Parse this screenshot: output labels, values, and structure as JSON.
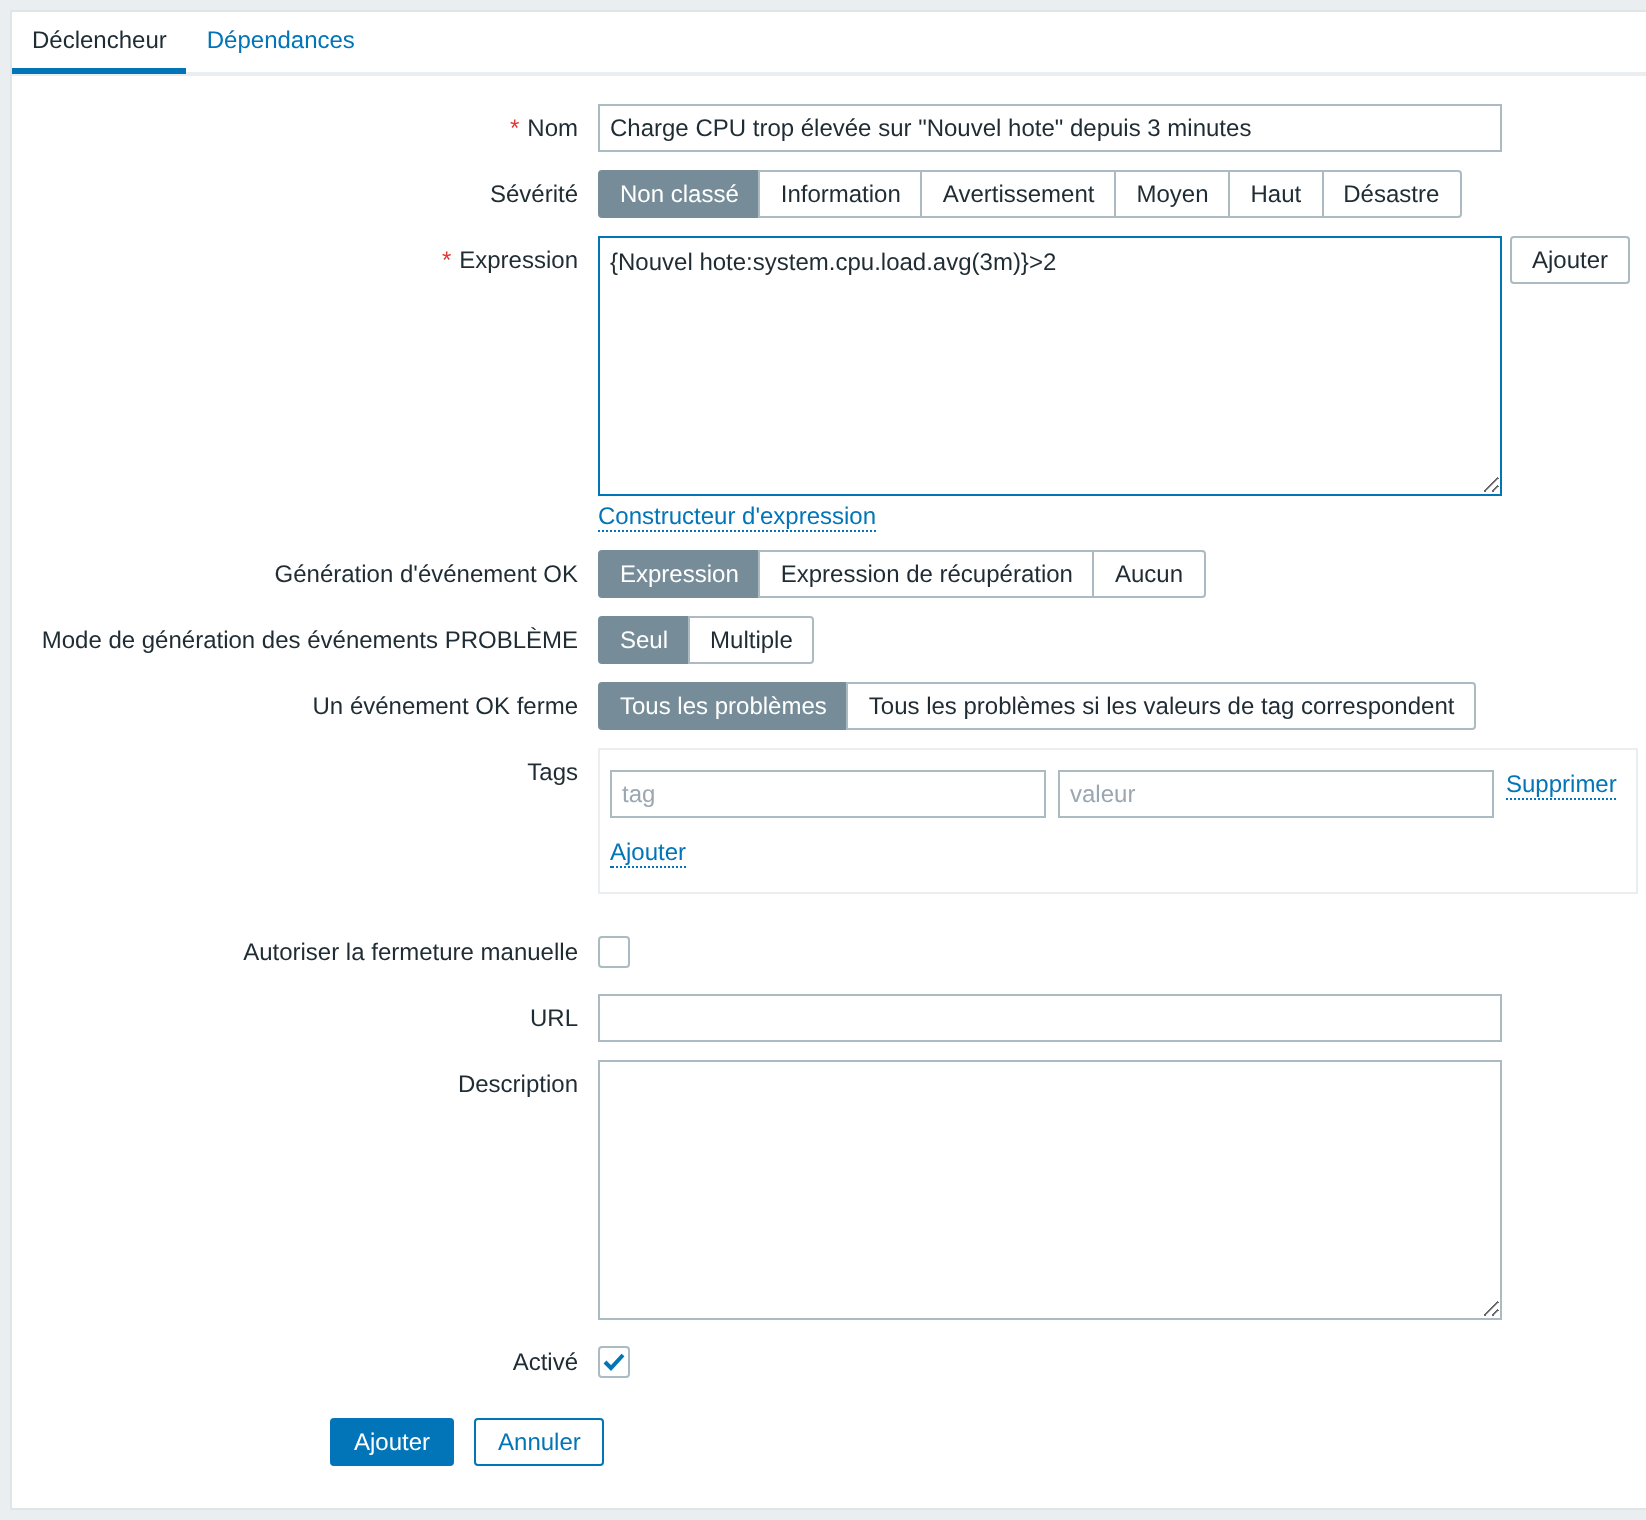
{
  "tabs": [
    {
      "label": "Déclencheur",
      "selected": true
    },
    {
      "label": "Dépendances",
      "selected": false
    }
  ],
  "fields": [
    {
      "kind": "input",
      "label": "Nom",
      "marker": "*",
      "value": "Charge CPU trop élevée sur \"Nouvel hote\" depuis 3 minutes"
    },
    {
      "kind": "segmented",
      "label": "Sévérité",
      "options": [
        {
          "label": "Non classé",
          "selected": true
        },
        {
          "label": "Information",
          "selected": false
        },
        {
          "label": "Avertissement",
          "selected": false
        },
        {
          "label": "Moyen",
          "selected": false
        },
        {
          "label": "Haut",
          "selected": false
        },
        {
          "label": "Désastre",
          "selected": false
        }
      ]
    },
    {
      "kind": "expression",
      "label": "Expression",
      "marker": "*",
      "value": "{Nouvel hote:system.cpu.load.avg(3m)}>2",
      "button": "Ajouter",
      "link": "Constructeur d'expression"
    },
    {
      "kind": "segmented",
      "label": "Génération d'événement OK",
      "options": [
        {
          "label": "Expression",
          "selected": true
        },
        {
          "label": "Expression de récupération",
          "selected": false
        },
        {
          "label": "Aucun",
          "selected": false
        }
      ]
    },
    {
      "kind": "segmented",
      "label": "Mode de génération des événements PROBLÈME",
      "options": [
        {
          "label": "Seul",
          "selected": true
        },
        {
          "label": "Multiple",
          "selected": false
        }
      ]
    },
    {
      "kind": "segmented",
      "label": "Un événement OK ferme",
      "options": [
        {
          "label": "Tous les problèmes",
          "selected": true
        },
        {
          "label": "Tous les problèmes si les valeurs de tag correspondent",
          "selected": false
        }
      ]
    },
    {
      "kind": "tags",
      "label": "Tags",
      "tag_placeholder": "tag",
      "value_placeholder": "valeur",
      "remove": "Supprimer",
      "add": "Ajouter"
    },
    {
      "kind": "checkbox",
      "label": "Autoriser la fermeture manuelle",
      "checked": false
    },
    {
      "kind": "input",
      "label": "URL"
    },
    {
      "kind": "textarea",
      "label": "Description"
    },
    {
      "kind": "checkbox",
      "label": "Activé",
      "checked": true
    }
  ],
  "buttons": [
    {
      "label": "Ajouter",
      "primary": true
    },
    {
      "label": "Annuler",
      "primary": false
    }
  ]
}
